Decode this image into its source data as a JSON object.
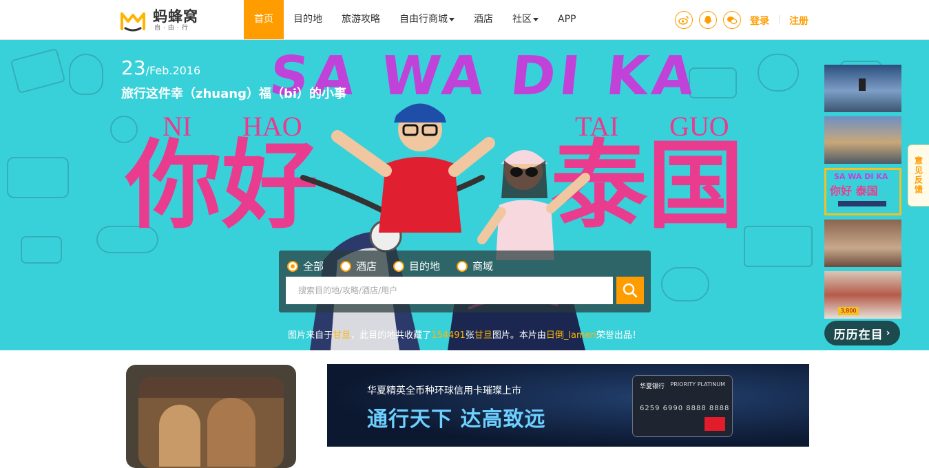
{
  "logo": {
    "title": "蚂蜂窝",
    "subtitle": "自·由·行"
  },
  "nav": [
    {
      "label": "首页",
      "active": true,
      "dropdown": false
    },
    {
      "label": "目的地",
      "active": false,
      "dropdown": false
    },
    {
      "label": "旅游攻略",
      "active": false,
      "dropdown": false
    },
    {
      "label": "自由行商城",
      "active": false,
      "dropdown": true
    },
    {
      "label": "酒店",
      "active": false,
      "dropdown": false
    },
    {
      "label": "社区",
      "active": false,
      "dropdown": true
    },
    {
      "label": "APP",
      "active": false,
      "dropdown": false
    }
  ],
  "social_icons": [
    "weibo-icon",
    "qq-icon",
    "wechat-icon"
  ],
  "auth": {
    "login": "登录",
    "register": "注册"
  },
  "banner": {
    "date_day": "23",
    "date_rest": "/Feb.2016",
    "tagline": "旅行这件幸（zhuang）福（bi）的小事",
    "headline": "SA WA DI KA",
    "latin_words": [
      "NI",
      "HAO",
      "TAI",
      "GUO"
    ],
    "hanzi": [
      "你",
      "好",
      "泰",
      "国"
    ]
  },
  "history_button": "历历在目",
  "feedback": "意见反馈",
  "search": {
    "options": [
      "全部",
      "酒店",
      "目的地",
      "商域"
    ],
    "selected": 0,
    "placeholder": "搜索目的地/攻略/酒店/用户"
  },
  "credit": {
    "p1": "图片来自于",
    "place": "甘旦",
    "p2": "，此目的地共收藏了",
    "count": "154491",
    "p3": "张",
    "place2": "甘旦",
    "p4": "图片。本片由",
    "author": "日倒_lamen",
    "p5": "荣誉出品！"
  },
  "ad": {
    "line1": "华夏精英全币种环球信用卡璀璨上市",
    "line2": "通行天下 达高致远",
    "card_bank": "华夏银行",
    "card_tier": "PRIORITY PLATINUM",
    "card_number": "6259 6990 8888 8888"
  },
  "colors": {
    "accent": "#ff9d00",
    "banner_bg": "#39d1d9",
    "hanzi": "#ea3c8f",
    "sawa": "#c042d8"
  }
}
